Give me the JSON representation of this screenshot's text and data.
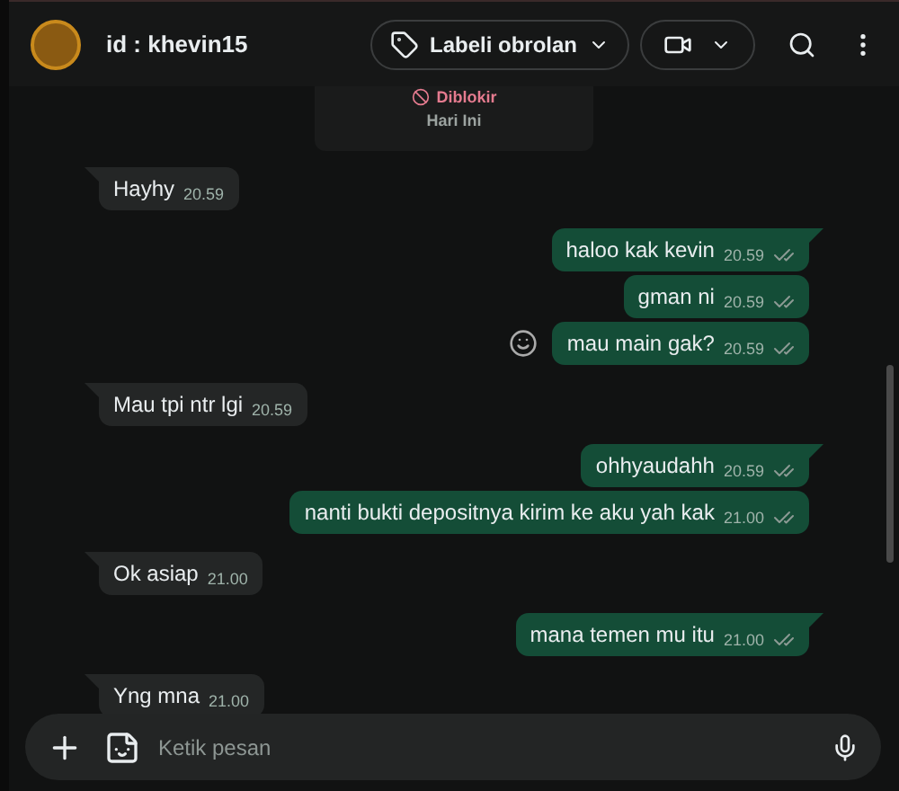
{
  "header": {
    "title": "id : khevin15",
    "label_button": "Labeli obrolan"
  },
  "system_card": {
    "status": "Diblokir",
    "date": "Hari Ini"
  },
  "messages": [
    {
      "kind": "in",
      "text": "Hayhy",
      "time": "20.59"
    },
    {
      "kind": "out",
      "text": "haloo kak kevin",
      "time": "20.59"
    },
    {
      "kind": "out",
      "text": "gman ni",
      "time": "20.59"
    },
    {
      "kind": "out",
      "text": "mau main gak?",
      "time": "20.59",
      "react_button": true
    },
    {
      "kind": "in",
      "text": "Mau tpi ntr lgi",
      "time": "20.59"
    },
    {
      "kind": "out",
      "text": "ohhyaudahh",
      "time": "20.59"
    },
    {
      "kind": "out",
      "text": "nanti bukti depositnya kirim ke aku yah kak",
      "time": "21.00"
    },
    {
      "kind": "in",
      "text": "Ok asiap",
      "time": "21.00"
    },
    {
      "kind": "out",
      "text": "mana temen mu itu",
      "time": "21.00"
    },
    {
      "kind": "in",
      "text": "Yng mna",
      "time": "21.00"
    }
  ],
  "composer": {
    "placeholder": "Ketik pesan"
  }
}
